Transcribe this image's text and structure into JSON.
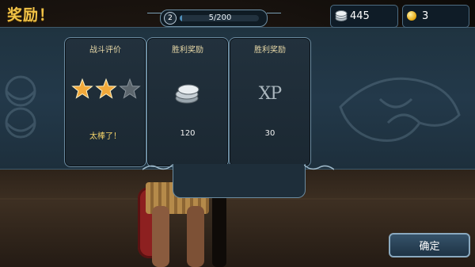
{
  "header": {
    "title": "奖励！",
    "progress": {
      "level": "2",
      "text": "5/200",
      "fraction": 0.025
    },
    "silver": "445",
    "gold": "3"
  },
  "cards": [
    {
      "title": "战斗评价",
      "value": "太棒了！",
      "stars_filled": 2,
      "stars_total": 3
    },
    {
      "title": "胜利奖励",
      "value": "120",
      "icon": "silver-coins-icon"
    },
    {
      "title": "胜利奖励",
      "value": "30",
      "icon": "xp-icon",
      "icon_text": "XP"
    }
  ],
  "confirm_label": "确定",
  "colors": {
    "gold_text": "#f0c247",
    "panel_border": "#6b8ba0",
    "banner_bg": "#23394a"
  }
}
